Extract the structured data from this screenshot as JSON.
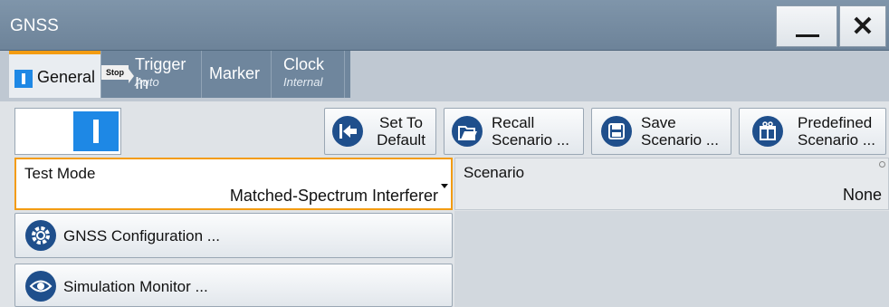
{
  "window": {
    "title": "GNSS",
    "minimize_icon": "minimize-icon",
    "close_glyph": "✕"
  },
  "tabs": [
    {
      "label": "General",
      "icon": "state-on-icon",
      "active": true
    },
    {
      "label": "Trigger In",
      "sub": "Auto",
      "badge": "Stop"
    },
    {
      "label": "Marker"
    },
    {
      "label": "Clock",
      "sub": "Internal"
    }
  ],
  "toolbar": {
    "state_toggle": "on",
    "set_default": "Set To Default",
    "recall": "Recall Scenario ...",
    "save": "Save Scenario ...",
    "predefined": "Predefined Scenario ..."
  },
  "test_mode": {
    "label": "Test Mode",
    "value": "Matched-Spectrum Interferer"
  },
  "scenario": {
    "label": "Scenario",
    "value": "None"
  },
  "buttons": {
    "gnss_config": "GNSS Configuration ...",
    "sim_monitor": "Simulation Monitor ..."
  },
  "colors": {
    "accent": "#f39c12",
    "toggle_on": "#1e88e5",
    "icon_bg": "#1f4f8c"
  }
}
